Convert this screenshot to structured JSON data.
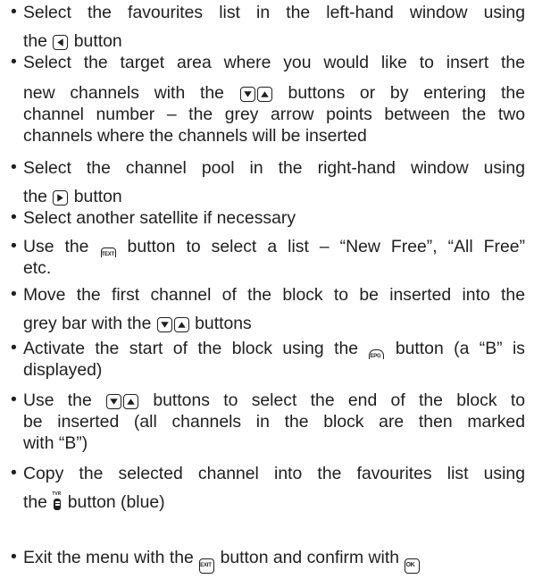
{
  "bullet": "•",
  "icons": {
    "left": "left-arrow-button-icon",
    "right": "right-arrow-button-icon",
    "down": "down-arrow-button-icon",
    "up": "up-arrow-button-icon",
    "text": "text-button-icon",
    "epg": "epg-button-icon",
    "blue": "tvr-blue-button-icon",
    "exit": "exit-button-icon",
    "ok": "ok-button-icon"
  },
  "items": [
    {
      "l1": "Select the favourites list in the left-hand window using",
      "l2a": "the",
      "l2b": "button"
    },
    {
      "l1": "Select the target area where you would like to insert the",
      "l2a": "new channels with the",
      "l2b": "buttons or by entering the",
      "l3": "channel number – the grey arrow points between the two",
      "l4": "channels where the channels will be inserted"
    },
    {
      "l1": "Select the channel pool in the right-hand window using",
      "l2a": "the",
      "l2b": "button"
    },
    {
      "l1": "Select another satellite if necessary"
    },
    {
      "l1a": "Use the",
      "l1b": "button to select a list – “New Free”, “All Free”",
      "l2": "etc."
    },
    {
      "l1": "Move the first channel of the block to be inserted into the",
      "l2a": "grey bar with the",
      "l2b": "buttons"
    },
    {
      "l1a": "Activate the start of the block using the",
      "l1b": "button (a “B” is",
      "l2": "displayed)"
    },
    {
      "l1a": "Use the",
      "l1b": "buttons to select the end of the block to",
      "l2": "be inserted (all channels in the block are then marked",
      "l3": "with “B”)"
    },
    {
      "l1": "Copy the selected channel into the favourites list using",
      "l2a": "the",
      "l2b": "button (blue)"
    },
    {
      "l1a": "Exit the menu with the",
      "l1b": "button and confirm with"
    }
  ],
  "key_labels": {
    "text": "TEXT",
    "epg": "EPG",
    "exit": "EXIT",
    "ok": "OK",
    "tvr": "TVR"
  }
}
